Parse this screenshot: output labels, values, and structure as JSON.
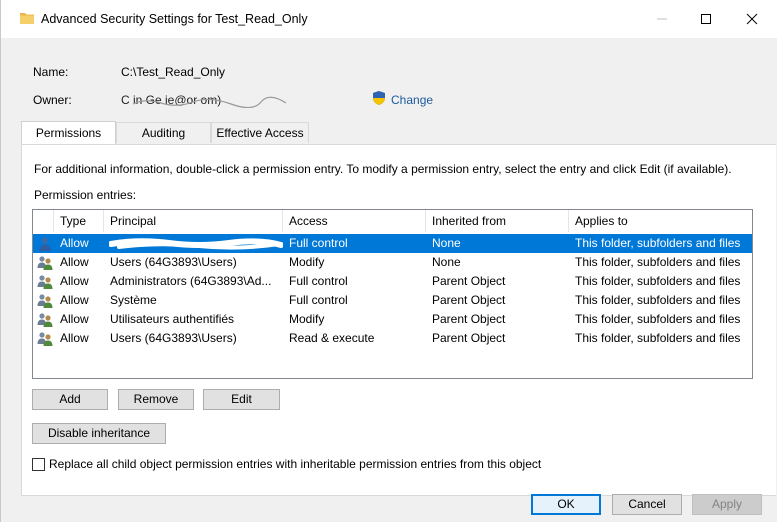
{
  "window": {
    "title": "Advanced Security Settings for Test_Read_Only"
  },
  "fields": {
    "name_label": "Name:",
    "name_value": "C:\\Test_Read_Only",
    "owner_label": "Owner:",
    "owner_value": "C        in  Ge                     ie@or             om)",
    "change_link": "Change"
  },
  "tabs": [
    {
      "label": "Permissions",
      "active": true
    },
    {
      "label": "Auditing",
      "active": false
    },
    {
      "label": "Effective Access",
      "active": false
    }
  ],
  "panel": {
    "info_text": "For additional information, double-click a permission entry. To modify a permission entry, select the entry and click Edit (if available).",
    "entries_label": "Permission entries:"
  },
  "table": {
    "columns": [
      "Type",
      "Principal",
      "Access",
      "Inherited from",
      "Applies to"
    ],
    "rows": [
      {
        "icon": "user-icon",
        "type": "Allow",
        "principal": "",
        "access": "Full control",
        "inherited": "None",
        "applies": "This folder, subfolders and files",
        "selected": true
      },
      {
        "icon": "group-icon",
        "type": "Allow",
        "principal": "Users (64G3893\\Users)",
        "access": "Modify",
        "inherited": "None",
        "applies": "This folder, subfolders and files",
        "selected": false
      },
      {
        "icon": "group-icon",
        "type": "Allow",
        "principal": "Administrators (64G3893\\Ad...",
        "access": "Full control",
        "inherited": "Parent Object",
        "applies": "This folder, subfolders and files",
        "selected": false
      },
      {
        "icon": "group-icon",
        "type": "Allow",
        "principal": "Système",
        "access": "Full control",
        "inherited": "Parent Object",
        "applies": "This folder, subfolders and files",
        "selected": false
      },
      {
        "icon": "group-icon",
        "type": "Allow",
        "principal": "Utilisateurs authentifiés",
        "access": "Modify",
        "inherited": "Parent Object",
        "applies": "This folder, subfolders and files",
        "selected": false
      },
      {
        "icon": "group-icon",
        "type": "Allow",
        "principal": "Users (64G3893\\Users)",
        "access": "Read & execute",
        "inherited": "Parent Object",
        "applies": "This folder, subfolders and files",
        "selected": false
      }
    ]
  },
  "buttons": {
    "add": "Add",
    "remove": "Remove",
    "edit": "Edit",
    "disable_inheritance": "Disable inheritance",
    "replace_checkbox": "Replace all child object permission entries with inheritable permission entries from this object",
    "replace_checked": false,
    "ok": "OK",
    "cancel": "Cancel",
    "apply": "Apply"
  },
  "colors": {
    "selection": "#0078d7",
    "link": "#1c5a9e",
    "folder": "#f0c54f"
  }
}
